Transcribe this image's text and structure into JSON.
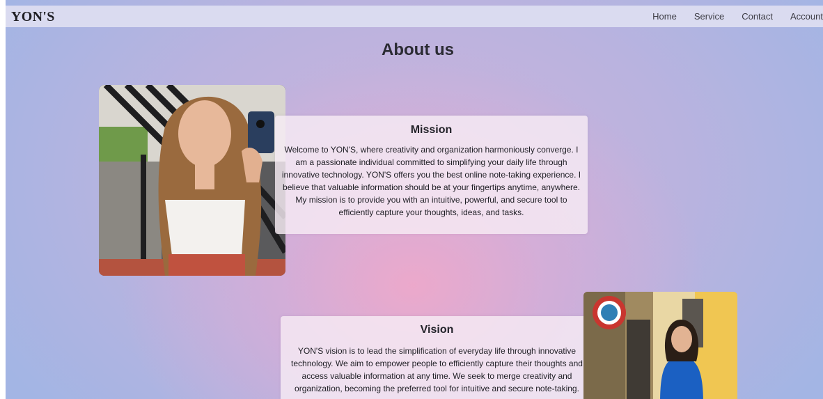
{
  "navbar": {
    "brand": "YON'S",
    "links": [
      "Home",
      "Service",
      "Contact",
      "Account"
    ]
  },
  "page_title": "About us",
  "mission": {
    "title": "Mission",
    "text": "Welcome to YON'S, where creativity and organization harmoniously converge. I am a passionate individual committed to simplifying your daily life through innovative technology. YON'S offers you the best online note-taking experience. I believe that valuable information should be at your fingertips anytime, anywhere. My mission is to provide you with an intuitive, powerful, and secure tool to efficiently capture your thoughts, ideas, and tasks."
  },
  "vision": {
    "title": "Vision",
    "text": "YON'S vision is to lead the simplification of everyday life through innovative technology. We aim to empower people to efficiently capture their thoughts and access valuable information at any time. We seek to merge creativity and organization, becoming the preferred tool for intuitive and secure note-taking."
  },
  "colors": {
    "navbar_bg": "#dadbf0",
    "card_bg": "#f6ecf4",
    "accent_pink": "#eea8ca",
    "accent_blue": "#a3b5e4"
  }
}
